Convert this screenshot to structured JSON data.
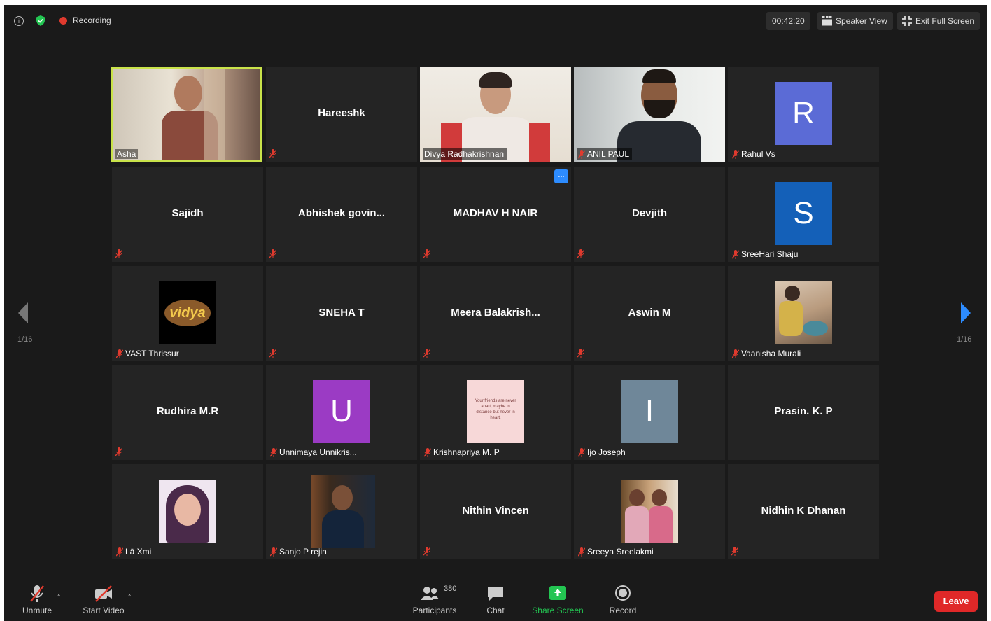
{
  "topbar": {
    "recording_label": "Recording",
    "timer": "00:42:20",
    "speaker_view_label": "Speaker View",
    "exit_fullscreen_label": "Exit Full Screen"
  },
  "participants": [
    {
      "name": "Asha",
      "kind": "video",
      "active": true
    },
    {
      "name": "Hareeshk",
      "kind": "name"
    },
    {
      "name": "Divya Radhakrishnan",
      "kind": "video"
    },
    {
      "name": "ANIL PAUL",
      "kind": "video"
    },
    {
      "name": "Rahul Vs",
      "kind": "avatar",
      "letter": "R",
      "color": "#5b6bd6"
    },
    {
      "name": "Sajidh",
      "kind": "name"
    },
    {
      "name": "Abhishek  govin...",
      "kind": "name"
    },
    {
      "name": "MADHAV H NAIR",
      "kind": "name",
      "more_button": "..."
    },
    {
      "name": "Devjith",
      "kind": "name"
    },
    {
      "name": "SreeHari Shaju",
      "kind": "avatar",
      "letter": "S",
      "color": "#1460b8"
    },
    {
      "name": "VAST Thrissur",
      "kind": "picture",
      "picture_text": "vidya"
    },
    {
      "name": "SNEHA T",
      "kind": "name"
    },
    {
      "name": "Meera  Balakrish...",
      "kind": "name"
    },
    {
      "name": "Aswin M",
      "kind": "name"
    },
    {
      "name": "Vaanisha Murali",
      "kind": "picture"
    },
    {
      "name": "Rudhira M.R",
      "kind": "name"
    },
    {
      "name": "Unnimaya Unnikris...",
      "kind": "avatar",
      "letter": "U",
      "color": "#9b3bc4"
    },
    {
      "name": "Krishnapriya M. P",
      "kind": "picture",
      "picture_text": "Your friends are never apart, maybe in distance but never in heart."
    },
    {
      "name": "Ijo Joseph",
      "kind": "avatar",
      "letter": "I",
      "color": "#6f8799"
    },
    {
      "name": "Prasin. K. P",
      "kind": "name"
    },
    {
      "name": "Lā Xmi",
      "kind": "picture"
    },
    {
      "name": "Sanjo P rejin",
      "kind": "picture"
    },
    {
      "name": "Nithin Vincen",
      "kind": "name"
    },
    {
      "name": "Sreeya Sreelakmi",
      "kind": "picture"
    },
    {
      "name": "Nidhin K Dhanan",
      "kind": "name"
    }
  ],
  "pagination": {
    "left": "1/16",
    "right": "1/16"
  },
  "toolbar": {
    "unmute_label": "Unmute",
    "start_video_label": "Start Video",
    "participants_label": "Participants",
    "participants_count": "380",
    "chat_label": "Chat",
    "share_screen_label": "Share Screen",
    "record_label": "Record",
    "leave_label": "Leave"
  },
  "colors": {
    "background": "#1a1a1a",
    "tile": "#242424",
    "active_border": "#c9e34a",
    "share_green": "#23c552",
    "leave_red": "#e02828",
    "mic_red": "#e03a2e"
  }
}
